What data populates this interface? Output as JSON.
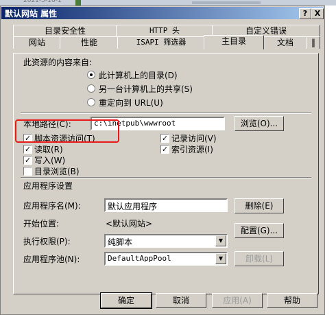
{
  "background": {
    "date_fragment": "2021-5-16-1"
  },
  "dialog": {
    "title": "默认网站 属性",
    "help_btn": "?",
    "close_btn": "X",
    "tabs_row1": [
      "目录安全性",
      "HTTP 头",
      "自定义错误"
    ],
    "tabs_row2": [
      "网站",
      "性能",
      "ISAPI 筛选器",
      "主目录",
      "文档"
    ],
    "active_tab": "主目录",
    "tab_scroll": "‖"
  },
  "content_source": {
    "label": "此资源的内容来自:",
    "options": [
      {
        "label": "此计算机上的目录(D)",
        "selected": true
      },
      {
        "label": "另一台计算机上的共享(S)",
        "selected": false
      },
      {
        "label": "重定向到 URL(U)",
        "selected": false
      }
    ]
  },
  "local_path": {
    "label": "本地路径(C):",
    "value": "c:\\inetpub\\wwwroot",
    "browse_btn": "浏览(O)..."
  },
  "permissions": {
    "script_source": {
      "label": "脚本资源访问(T)",
      "checked": true
    },
    "read": {
      "label": "读取(R)",
      "checked": true
    },
    "write": {
      "label": "写入(W)",
      "checked": true
    },
    "dir_browse": {
      "label": "目录浏览(B)",
      "checked": false
    },
    "log_visits": {
      "label": "记录访问(V)",
      "checked": true
    },
    "index_resource": {
      "label": "索引资源(I)",
      "checked": true
    }
  },
  "app_settings": {
    "section_label": "应用程序设置",
    "app_name_label": "应用程序名(M):",
    "app_name_value": "默认应用程序",
    "remove_btn": "删除(E)",
    "start_point_label": "开始位置:",
    "start_point_value": "<默认网站>",
    "config_btn": "配置(G)...",
    "exec_perm_label": "执行权限(P):",
    "exec_perm_value": "纯脚本",
    "app_pool_label": "应用程序池(N):",
    "app_pool_value": "DefaultAppPool",
    "unload_btn": "卸载(L)"
  },
  "footer": {
    "ok": "确定",
    "cancel": "取消",
    "apply": "应用(A)",
    "help": "帮助"
  },
  "check_mark": "✓",
  "dropdown_arrow": "▼",
  "colors": {
    "highlight_box": "#e81818",
    "title_bar": "#0a246a",
    "dialog_face": "#d4d0c8"
  }
}
